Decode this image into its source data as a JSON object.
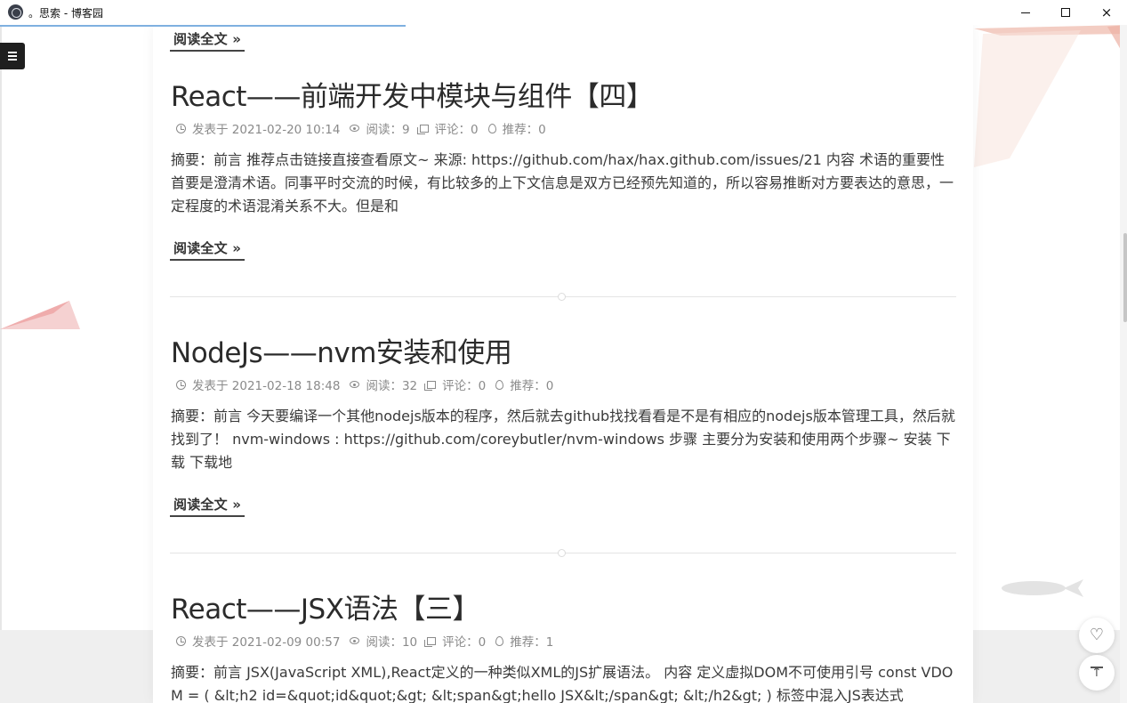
{
  "window": {
    "title": "。思索 - 博客园",
    "minimize": "minimize",
    "maximize": "maximize",
    "close": "×"
  },
  "readmore_label": "阅读全文 »",
  "posts": [
    {
      "title": "React——前端开发中模块与组件【四】",
      "posted": "发表于 2021-02-20 10:14",
      "views": "阅读：9",
      "comments": "评论：0",
      "recommend": "推荐：0",
      "summary": "摘要：前言 推荐点击链接直接查看原文~ 来源: https://github.com/hax/hax.github.com/issues/21 内容 术语的重要性 首要是澄清术语。同事平时交流的时候，有比较多的上下文信息是双方已经预先知道的，所以容易推断对方要表达的意思，一定程度的术语混淆关系不大。但是和"
    },
    {
      "title": "NodeJs——nvm安装和使用",
      "posted": "发表于 2021-02-18 18:48",
      "views": "阅读：32",
      "comments": "评论：0",
      "recommend": "推荐：0",
      "summary": "摘要：前言 今天要编译一个其他nodejs版本的程序，然后就去github找找看看是不是有相应的nodejs版本管理工具，然后就找到了！ nvm-windows : https://github.com/coreybutler/nvm-windows 步骤 主要分为安装和使用两个步骤~ 安装 下载 下载地"
    },
    {
      "title": "React——JSX语法【三】",
      "posted": "发表于 2021-02-09 00:57",
      "views": "阅读：10",
      "comments": "评论：0",
      "recommend": "推荐：1",
      "summary": "摘要：前言 JSX(JavaScript XML),React定义的一种类似XML的JS扩展语法。 内容 定义虚拟DOM不可使用引号 const VDOM = ( &lt;h2 id=&quot;id&quot;&gt; &lt;span&gt;hello JSX&lt;/span&gt; &lt;/h2&gt; ) 标签中混入JS表达式"
    }
  ],
  "floating": {
    "like_icon": "heart-icon",
    "top_icon": "arrow-to-top-icon"
  },
  "colors": {
    "title_text": "#2b2b2b",
    "meta_text": "#8a8a8a",
    "body_text": "#3a3a3a",
    "accent_pink": "#f2b8b8",
    "menu_bg": "#1f1f1f"
  }
}
